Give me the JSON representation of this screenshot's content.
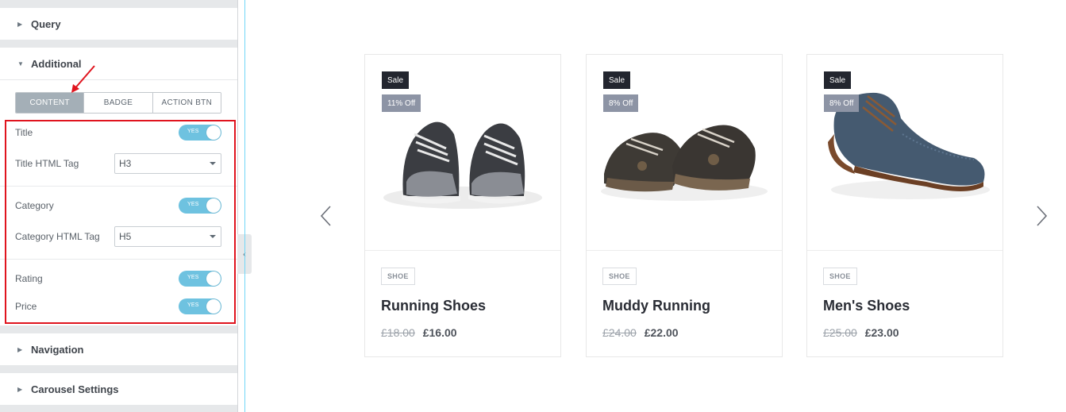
{
  "panel": {
    "sections": {
      "query": "Query",
      "additional": "Additional",
      "navigation": "Navigation",
      "carousel": "Carousel Settings"
    },
    "tabs": [
      "CONTENT",
      "BADGE",
      "ACTION BTN"
    ],
    "active_tab": "CONTENT",
    "controls": {
      "title": {
        "label": "Title",
        "toggle": "YES"
      },
      "title_tag": {
        "label": "Title HTML Tag",
        "value": "H3"
      },
      "category": {
        "label": "Category",
        "toggle": "YES"
      },
      "category_tag": {
        "label": "Category HTML Tag",
        "value": "H5"
      },
      "rating": {
        "label": "Rating",
        "toggle": "YES"
      },
      "price": {
        "label": "Price",
        "toggle": "YES"
      }
    },
    "accent_color": "#6ec2e0",
    "highlight_color": "#e0141e"
  },
  "products": [
    {
      "sale": "Sale",
      "discount": "11% Off",
      "category": "SHOE",
      "title": "Running Shoes",
      "old_price": "£18.00",
      "new_price": "£16.00",
      "image": "sneakers-grey"
    },
    {
      "sale": "Sale",
      "discount": "8% Off",
      "category": "SHOE",
      "title": "Muddy Running",
      "old_price": "£24.00",
      "new_price": "£22.00",
      "image": "sneakers-muddy"
    },
    {
      "sale": "Sale",
      "discount": "8% Off",
      "category": "SHOE",
      "title": "Men's Shoes",
      "old_price": "£25.00",
      "new_price": "£23.00",
      "image": "brogue-blue"
    }
  ]
}
